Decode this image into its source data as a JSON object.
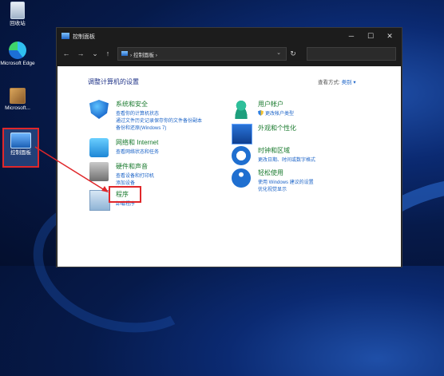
{
  "desktop": {
    "icons": [
      {
        "label": "回收站"
      },
      {
        "label": "Microsoft Edge"
      },
      {
        "label": "Microsoft..."
      },
      {
        "label": "控制面板"
      }
    ]
  },
  "window": {
    "title": "控制面板",
    "controls": {
      "minimize": "─",
      "maximize": "☐",
      "close": "✕"
    },
    "nav": {
      "back": "←",
      "forward": "→",
      "recent": "⌄",
      "up": "↑",
      "refresh": "↻"
    },
    "address": {
      "path": "控制面板",
      "separator": "›",
      "dropdown": "⌄"
    },
    "search": {
      "placeholder": ""
    }
  },
  "content": {
    "heading": "调整计算机的设置",
    "view_by": {
      "label": "查看方式:",
      "value": "类别 ▾"
    },
    "categories_left": [
      {
        "title": "系统和安全",
        "links": [
          "查看你的计算机状态",
          "通过文件历史记录保存你的文件备份副本",
          "备份和还原(Windows 7)"
        ],
        "icon": "shield-icon"
      },
      {
        "title": "网络和 Internet",
        "links": [
          "查看网络状态和任务"
        ],
        "icon": "network-icon"
      },
      {
        "title": "硬件和声音",
        "links": [
          "查看设备和打印机",
          "添加设备"
        ],
        "icon": "printer-icon"
      },
      {
        "title": "程序",
        "links": [
          "卸载程序"
        ],
        "icon": "programs-icon"
      }
    ],
    "categories_right": [
      {
        "title": "用户帐户",
        "links": [
          "更改帐户类型"
        ],
        "icon": "user-icon"
      },
      {
        "title": "外观和个性化",
        "links": [],
        "icon": "appearance-icon"
      },
      {
        "title": "时钟和区域",
        "links": [
          "更改日期、时间或数字格式"
        ],
        "icon": "clock-icon"
      },
      {
        "title": "轻松使用",
        "links": [
          "使用 Windows 建议的设置",
          "优化视觉显示"
        ],
        "icon": "accessibility-icon"
      }
    ]
  },
  "colors": {
    "highlight": "#e0272a",
    "link": "#1b63c7",
    "category_title": "#1a7a2e",
    "heading": "#1e3287"
  }
}
